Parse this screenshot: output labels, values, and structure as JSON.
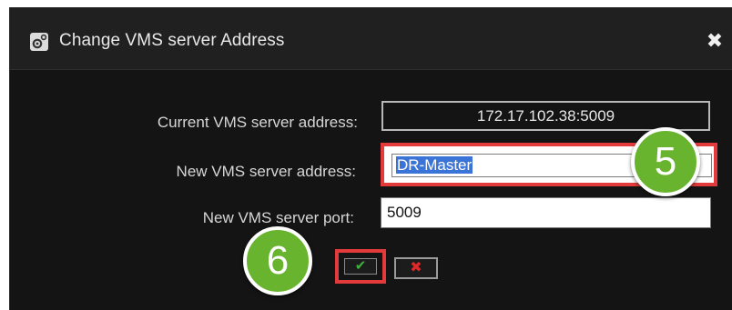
{
  "window": {
    "title": "Change VMS server Address",
    "icon": "gear-icon",
    "close_icon": "close-icon",
    "close_glyph": "✖"
  },
  "form": {
    "current_label": "Current VMS server address:",
    "current_value": "172.17.102.38:5009",
    "new_label": "New VMS server address:",
    "new_value": "DR-Master",
    "port_label": "New VMS server port:",
    "port_value": "5009"
  },
  "buttons": {
    "ok_glyph": "✔",
    "cancel_glyph": "✖"
  },
  "annotations": {
    "step_new_address": "5",
    "step_ok": "6",
    "highlight_color": "#e33b3b",
    "badge_color": "#69b42f"
  }
}
